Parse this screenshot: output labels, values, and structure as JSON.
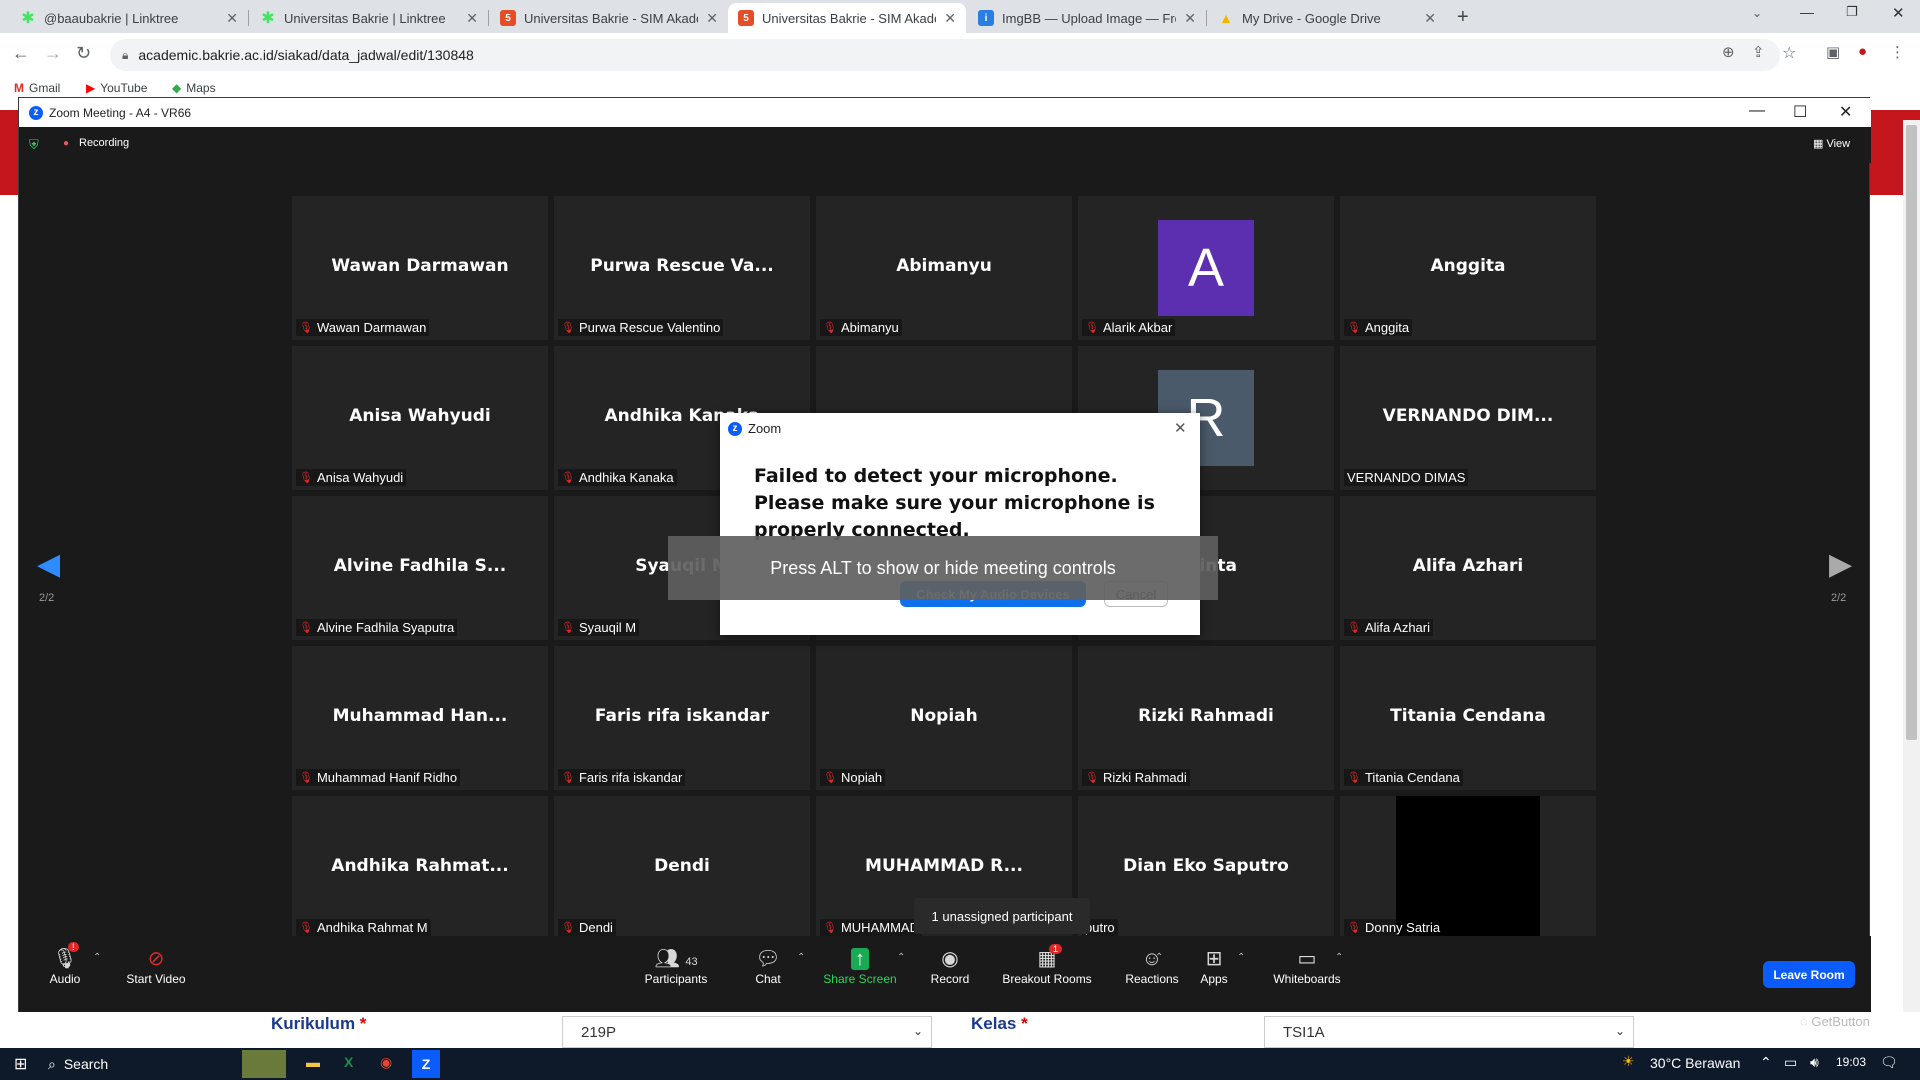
{
  "browser": {
    "tabs": [
      {
        "title": "@baaubakrie | Linktree",
        "icon": "linktree-icon",
        "color": "#43e55e"
      },
      {
        "title": "Universitas Bakrie | Linktree",
        "icon": "linktree-icon",
        "color": "#43e55e"
      },
      {
        "title": "Universitas Bakrie - SIM Akadem",
        "icon": "html5-icon",
        "color": "#e44d26"
      },
      {
        "title": "Universitas Bakrie - SIM Akadem",
        "icon": "html5-icon",
        "color": "#e44d26"
      },
      {
        "title": "ImgBB — Upload Image — Free",
        "icon": "imgbb-icon",
        "color": "#2a7de1"
      },
      {
        "title": "My Drive - Google Drive",
        "icon": "drive-icon",
        "color": "#f4b400"
      }
    ],
    "url": "academic.bakrie.ac.id/siakad/data_jadwal/edit/130848",
    "bookmarks": [
      "Gmail",
      "YouTube",
      "Maps"
    ]
  },
  "zoom": {
    "window_title": "Zoom Meeting - A4 - VR66",
    "recording_label": "Recording",
    "view_label": "View",
    "page_indicator_left": "2/2",
    "page_indicator_right": "2/2",
    "participants": [
      {
        "name": "Wawan Darmawan",
        "label": "Wawan Darmawan",
        "muted": true
      },
      {
        "name": "Purwa Rescue Va...",
        "label": "Purwa Rescue Valentino",
        "muted": true
      },
      {
        "name": "Abimanyu",
        "label": "Abimanyu",
        "muted": true
      },
      {
        "name": "A",
        "label": "Alarik Akbar",
        "muted": true,
        "avatar": true,
        "avatar_color": "#5b2fb0"
      },
      {
        "name": "Anggita",
        "label": "Anggita",
        "muted": true
      },
      {
        "name": "Anisa Wahyudi",
        "label": "Anisa Wahyudi",
        "muted": true
      },
      {
        "name": "Andhika Kanaka",
        "label": "Andhika Kanaka",
        "muted": true
      },
      {
        "name": "",
        "label": "",
        "muted": false
      },
      {
        "name": "R",
        "label": "liany",
        "muted": false,
        "avatar": true,
        "avatar_color": "#4a5a6a"
      },
      {
        "name": "VERNANDO DIM...",
        "label": "VERNANDO DIMAS",
        "muted": false
      },
      {
        "name": "Alvine Fadhila S...",
        "label": "Alvine Fadhila Syaputra",
        "muted": true
      },
      {
        "name": "Syauqil M",
        "label": "Syauqil M",
        "muted": true
      },
      {
        "name": "",
        "label": "",
        "muted": false
      },
      {
        "name": "Shinta",
        "label": "",
        "muted": false
      },
      {
        "name": "Alifa Azhari",
        "label": "Alifa Azhari",
        "muted": true
      },
      {
        "name": "Muhammad Han...",
        "label": "Muhammad Hanif Ridho",
        "muted": true
      },
      {
        "name": "Faris rifa iskandar",
        "label": "Faris rifa iskandar",
        "muted": true
      },
      {
        "name": "Nopiah",
        "label": "Nopiah",
        "muted": true
      },
      {
        "name": "Rizki Rahmadi",
        "label": "Rizki Rahmadi",
        "muted": true
      },
      {
        "name": "Titania Cendana",
        "label": "Titania Cendana",
        "muted": true
      },
      {
        "name": "Andhika Rahmat...",
        "label": "Andhika Rahmat M",
        "muted": true
      },
      {
        "name": "Dendi",
        "label": "Dendi",
        "muted": true
      },
      {
        "name": "MUHAMMAD R...",
        "label": "MUHAMMAD",
        "muted": true
      },
      {
        "name": "Dian Eko Saputro",
        "label": "putro",
        "muted": false
      },
      {
        "name": "",
        "label": "Donny Satria",
        "muted": true,
        "video_black": true
      }
    ],
    "controls": {
      "audio": "Audio",
      "start_video": "Start Video",
      "participants": "Participants",
      "participants_count": "43",
      "chat": "Chat",
      "share_screen": "Share Screen",
      "record": "Record",
      "breakout_rooms": "Breakout Rooms",
      "breakout_badge": "1",
      "reactions": "Reactions",
      "apps": "Apps",
      "whiteboards": "Whiteboards",
      "leave": "Leave Room",
      "audio_badge": "!"
    },
    "dialog": {
      "title": "Zoom",
      "message": "Failed to detect your microphone. Please make sure your microphone is properly connected.",
      "primary_button": "Check My Audio Devices",
      "cancel_button": "Cancel"
    },
    "overlay_hint": "Press ALT to show or hide meeting controls",
    "tooltip": "1 unassigned participant"
  },
  "page": {
    "kurikulum_label": "Kurikulum",
    "kurikulum_value": "219P",
    "kelas_label": "Kelas",
    "kelas_value": "TSI1A",
    "watermark": "GetButton"
  },
  "taskbar": {
    "search": "Search",
    "weather": "30°C Berawan",
    "time": "19:03"
  },
  "colors": {
    "accent_blue": "#0b5cff",
    "mute_red": "#e02828",
    "share_green": "#1aaa55"
  }
}
